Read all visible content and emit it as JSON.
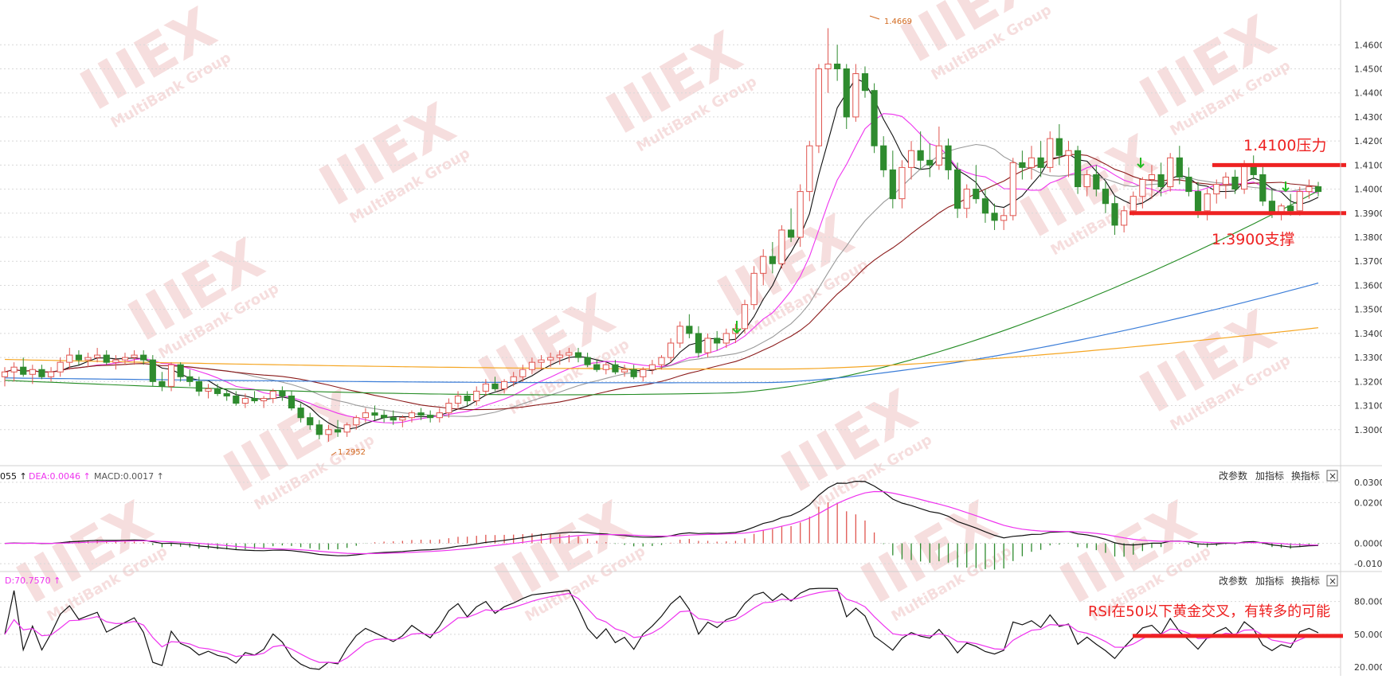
{
  "colors": {
    "up_candle": "#e0554f",
    "down_candle": "#2e8b2e",
    "ma_black": "#111111",
    "ma_magenta": "#ee33ee",
    "ma_gray": "#999999",
    "ma_darkred": "#8b1a1a",
    "ma_green": "#228b22",
    "ma_blue": "#3b7dd8",
    "ma_orange": "#f5a623",
    "annotation_red": "#ee2222",
    "grid": "#d8d8d8"
  },
  "watermark": {
    "brand": "IIIEX",
    "group": "MultiBank Group"
  },
  "main_panel": {
    "high_label": "1.4669",
    "low_label": "1.2952"
  },
  "annotations": {
    "resistance_text": "1.4100压力",
    "support_text": "1.3900支撑",
    "rsi_text": "RSI在50以下黄金交叉，有转多的可能"
  },
  "macd_panel": {
    "legend_dif": "055 ↑",
    "legend_dea": "DEA:0.0046 ↑",
    "legend_macd": "MACD:0.0017 ↑"
  },
  "rsi_panel": {
    "legend_d": "D:70.7570 ↑"
  },
  "toolbar": {
    "change_params": "改参数",
    "add_indicator": "加指标",
    "switch_indicator": "换指标",
    "close_symbol": "×"
  },
  "chart_data": [
    {
      "type": "candlestick",
      "y_ticks": [
        "1.4600",
        "1.4500",
        "1.4400",
        "1.4300",
        "1.4200",
        "1.4100",
        "1.4000",
        "1.3900",
        "1.3800",
        "1.3700",
        "1.3600",
        "1.3500",
        "1.3400",
        "1.3300",
        "1.3200",
        "1.3100",
        "1.3000"
      ],
      "ylim": [
        1.29,
        1.472
      ],
      "annotations": {
        "resistance": 1.41,
        "support": 1.39,
        "high": 1.4669,
        "low": 1.2952
      },
      "candles": [
        [
          1.322,
          1.326,
          1.318,
          1.324
        ],
        [
          1.324,
          1.328,
          1.32,
          1.326
        ],
        [
          1.326,
          1.33,
          1.322,
          1.323
        ],
        [
          1.323,
          1.327,
          1.319,
          1.325
        ],
        [
          1.325,
          1.327,
          1.321,
          1.322
        ],
        [
          1.322,
          1.326,
          1.32,
          1.324
        ],
        [
          1.324,
          1.33,
          1.322,
          1.328
        ],
        [
          1.328,
          1.334,
          1.325,
          1.331
        ],
        [
          1.331,
          1.333,
          1.327,
          1.329
        ],
        [
          1.329,
          1.332,
          1.326,
          1.33
        ],
        [
          1.33,
          1.334,
          1.328,
          1.331
        ],
        [
          1.331,
          1.333,
          1.327,
          1.328
        ],
        [
          1.328,
          1.331,
          1.325,
          1.329
        ],
        [
          1.329,
          1.332,
          1.327,
          1.33
        ],
        [
          1.33,
          1.333,
          1.327,
          1.331
        ],
        [
          1.331,
          1.333,
          1.327,
          1.329
        ],
        [
          1.329,
          1.331,
          1.318,
          1.32
        ],
        [
          1.32,
          1.324,
          1.316,
          1.318
        ],
        [
          1.318,
          1.328,
          1.316,
          1.327
        ],
        [
          1.327,
          1.328,
          1.32,
          1.322
        ],
        [
          1.322,
          1.325,
          1.318,
          1.32
        ],
        [
          1.32,
          1.322,
          1.314,
          1.316
        ],
        [
          1.316,
          1.319,
          1.313,
          1.317
        ],
        [
          1.317,
          1.319,
          1.314,
          1.315
        ],
        [
          1.315,
          1.317,
          1.312,
          1.314
        ],
        [
          1.314,
          1.316,
          1.31,
          1.311
        ],
        [
          1.311,
          1.315,
          1.309,
          1.313
        ],
        [
          1.313,
          1.316,
          1.311,
          1.312
        ],
        [
          1.312,
          1.314,
          1.309,
          1.313
        ],
        [
          1.313,
          1.317,
          1.311,
          1.316
        ],
        [
          1.316,
          1.318,
          1.312,
          1.314
        ],
        [
          1.314,
          1.316,
          1.308,
          1.309
        ],
        [
          1.309,
          1.311,
          1.303,
          1.305
        ],
        [
          1.305,
          1.307,
          1.3,
          1.302
        ],
        [
          1.302,
          1.304,
          1.296,
          1.298
        ],
        [
          1.298,
          1.302,
          1.295,
          1.3
        ],
        [
          1.3,
          1.304,
          1.297,
          1.299
        ],
        [
          1.299,
          1.303,
          1.297,
          1.302
        ],
        [
          1.302,
          1.306,
          1.3,
          1.305
        ],
        [
          1.305,
          1.309,
          1.303,
          1.307
        ],
        [
          1.307,
          1.31,
          1.304,
          1.306
        ],
        [
          1.306,
          1.308,
          1.303,
          1.305
        ],
        [
          1.305,
          1.308,
          1.302,
          1.304
        ],
        [
          1.304,
          1.306,
          1.301,
          1.305
        ],
        [
          1.305,
          1.308,
          1.303,
          1.307
        ],
        [
          1.307,
          1.309,
          1.304,
          1.306
        ],
        [
          1.306,
          1.308,
          1.303,
          1.305
        ],
        [
          1.305,
          1.309,
          1.303,
          1.307
        ],
        [
          1.307,
          1.313,
          1.305,
          1.311
        ],
        [
          1.311,
          1.316,
          1.309,
          1.314
        ],
        [
          1.314,
          1.316,
          1.31,
          1.312
        ],
        [
          1.312,
          1.318,
          1.31,
          1.316
        ],
        [
          1.316,
          1.321,
          1.314,
          1.319
        ],
        [
          1.319,
          1.322,
          1.316,
          1.317
        ],
        [
          1.317,
          1.321,
          1.315,
          1.32
        ],
        [
          1.32,
          1.324,
          1.318,
          1.322
        ],
        [
          1.322,
          1.327,
          1.32,
          1.325
        ],
        [
          1.325,
          1.33,
          1.323,
          1.328
        ],
        [
          1.328,
          1.331,
          1.325,
          1.329
        ],
        [
          1.329,
          1.332,
          1.326,
          1.33
        ],
        [
          1.33,
          1.333,
          1.327,
          1.331
        ],
        [
          1.331,
          1.334,
          1.328,
          1.332
        ],
        [
          1.332,
          1.334,
          1.328,
          1.33
        ],
        [
          1.33,
          1.332,
          1.326,
          1.327
        ],
        [
          1.327,
          1.329,
          1.324,
          1.325
        ],
        [
          1.325,
          1.328,
          1.323,
          1.327
        ],
        [
          1.327,
          1.329,
          1.323,
          1.324
        ],
        [
          1.324,
          1.327,
          1.322,
          1.325
        ],
        [
          1.325,
          1.327,
          1.321,
          1.322
        ],
        [
          1.322,
          1.326,
          1.32,
          1.325
        ],
        [
          1.325,
          1.329,
          1.323,
          1.327
        ],
        [
          1.327,
          1.331,
          1.325,
          1.33
        ],
        [
          1.33,
          1.338,
          1.328,
          1.336
        ],
        [
          1.336,
          1.345,
          1.334,
          1.343
        ],
        [
          1.343,
          1.348,
          1.338,
          1.34
        ],
        [
          1.34,
          1.343,
          1.33,
          1.332
        ],
        [
          1.332,
          1.34,
          1.33,
          1.338
        ],
        [
          1.338,
          1.341,
          1.333,
          1.336
        ],
        [
          1.336,
          1.342,
          1.334,
          1.34
        ],
        [
          1.34,
          1.344,
          1.336,
          1.342
        ],
        [
          1.342,
          1.354,
          1.34,
          1.352
        ],
        [
          1.352,
          1.368,
          1.35,
          1.365
        ],
        [
          1.365,
          1.375,
          1.36,
          1.372
        ],
        [
          1.372,
          1.378,
          1.365,
          1.369
        ],
        [
          1.369,
          1.385,
          1.367,
          1.383
        ],
        [
          1.383,
          1.392,
          1.378,
          1.38
        ],
        [
          1.38,
          1.402,
          1.376,
          1.399
        ],
        [
          1.399,
          1.42,
          1.395,
          1.418
        ],
        [
          1.418,
          1.452,
          1.415,
          1.45
        ],
        [
          1.45,
          1.4669,
          1.44,
          1.452
        ],
        [
          1.452,
          1.46,
          1.445,
          1.45
        ],
        [
          1.45,
          1.452,
          1.425,
          1.43
        ],
        [
          1.43,
          1.452,
          1.428,
          1.448
        ],
        [
          1.448,
          1.451,
          1.438,
          1.441
        ],
        [
          1.441,
          1.444,
          1.415,
          1.418
        ],
        [
          1.418,
          1.422,
          1.405,
          1.408
        ],
        [
          1.408,
          1.416,
          1.392,
          1.396
        ],
        [
          1.396,
          1.412,
          1.392,
          1.409
        ],
        [
          1.409,
          1.42,
          1.404,
          1.416
        ],
        [
          1.416,
          1.424,
          1.408,
          1.412
        ],
        [
          1.412,
          1.419,
          1.405,
          1.41
        ],
        [
          1.41,
          1.426,
          1.408,
          1.418
        ],
        [
          1.418,
          1.421,
          1.404,
          1.408
        ],
        [
          1.408,
          1.411,
          1.388,
          1.392
        ],
        [
          1.392,
          1.402,
          1.388,
          1.4
        ],
        [
          1.4,
          1.41,
          1.394,
          1.396
        ],
        [
          1.396,
          1.4,
          1.386,
          1.39
        ],
        [
          1.39,
          1.394,
          1.383,
          1.387
        ],
        [
          1.387,
          1.392,
          1.383,
          1.389
        ],
        [
          1.389,
          1.413,
          1.387,
          1.411
        ],
        [
          1.411,
          1.416,
          1.404,
          1.409
        ],
        [
          1.409,
          1.418,
          1.404,
          1.413
        ],
        [
          1.413,
          1.42,
          1.405,
          1.409
        ],
        [
          1.409,
          1.424,
          1.407,
          1.421
        ],
        [
          1.421,
          1.427,
          1.41,
          1.414
        ],
        [
          1.414,
          1.42,
          1.405,
          1.416
        ],
        [
          1.416,
          1.418,
          1.398,
          1.401
        ],
        [
          1.401,
          1.408,
          1.397,
          1.406
        ],
        [
          1.406,
          1.41,
          1.397,
          1.4
        ],
        [
          1.4,
          1.403,
          1.39,
          1.394
        ],
        [
          1.394,
          1.397,
          1.381,
          1.385
        ],
        [
          1.385,
          1.393,
          1.382,
          1.391
        ],
        [
          1.391,
          1.399,
          1.389,
          1.397
        ],
        [
          1.397,
          1.405,
          1.392,
          1.404
        ],
        [
          1.404,
          1.41,
          1.396,
          1.406
        ],
        [
          1.406,
          1.411,
          1.397,
          1.401
        ],
        [
          1.401,
          1.415,
          1.399,
          1.413
        ],
        [
          1.413,
          1.418,
          1.402,
          1.405
        ],
        [
          1.405,
          1.409,
          1.397,
          1.399
        ],
        [
          1.399,
          1.403,
          1.388,
          1.391
        ],
        [
          1.391,
          1.4,
          1.387,
          1.398
        ],
        [
          1.398,
          1.404,
          1.394,
          1.402
        ],
        [
          1.402,
          1.407,
          1.396,
          1.405
        ],
        [
          1.405,
          1.408,
          1.398,
          1.4
        ],
        [
          1.4,
          1.412,
          1.398,
          1.41
        ],
        [
          1.41,
          1.414,
          1.404,
          1.406
        ],
        [
          1.406,
          1.41,
          1.393,
          1.395
        ],
        [
          1.395,
          1.4,
          1.388,
          1.39
        ],
        [
          1.39,
          1.394,
          1.387,
          1.393
        ],
        [
          1.393,
          1.398,
          1.389,
          1.391
        ],
        [
          1.391,
          1.401,
          1.389,
          1.399
        ],
        [
          1.399,
          1.404,
          1.396,
          1.401
        ],
        [
          1.401,
          1.403,
          1.397,
          1.399
        ]
      ]
    },
    {
      "type": "macd",
      "y_ticks": [
        "0.0300",
        "0.0200",
        "0.0000",
        "-0.0100"
      ]
    },
    {
      "type": "line",
      "name": "RSI",
      "y_ticks": [
        "80.0000",
        "50.0000",
        "20.0000"
      ],
      "ylim": [
        15,
        95
      ]
    }
  ]
}
